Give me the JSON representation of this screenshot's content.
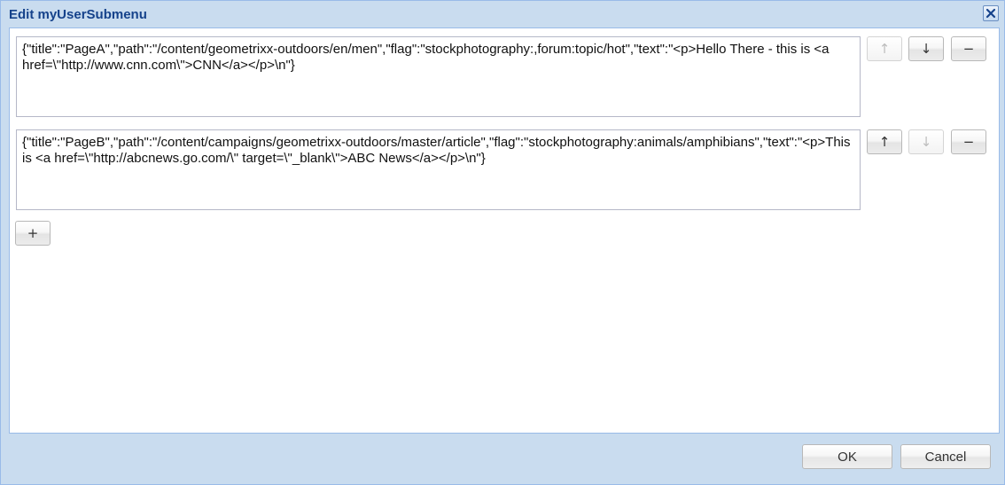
{
  "dialog": {
    "title": "Edit myUserSubmenu",
    "close_icon": "close-icon"
  },
  "items": [
    {
      "value": "{\"title\":\"PageA\",\"path\":\"/content/geometrixx-outdoors/en/men\",\"flag\":\"stockphotography:,forum:topic/hot\",\"text\":\"<p>Hello There - this is <a href=\\\"http://www.cnn.com\\\">CNN</a></p>\\n\"}",
      "up_label": "↑",
      "down_label": "↓",
      "remove_label": "−",
      "up_enabled": false,
      "down_enabled": true
    },
    {
      "value": "{\"title\":\"PageB\",\"path\":\"/content/campaigns/geometrixx-outdoors/master/article\",\"flag\":\"stockphotography:animals/amphibians\",\"text\":\"<p>This is <a href=\\\"http://abcnews.go.com/\\\" target=\\\"_blank\\\">ABC News</a></p>\\n\"}",
      "up_label": "↑",
      "down_label": "↓",
      "remove_label": "−",
      "up_enabled": true,
      "down_enabled": false
    }
  ],
  "add_label": "+",
  "footer": {
    "ok_label": "OK",
    "cancel_label": "Cancel"
  }
}
